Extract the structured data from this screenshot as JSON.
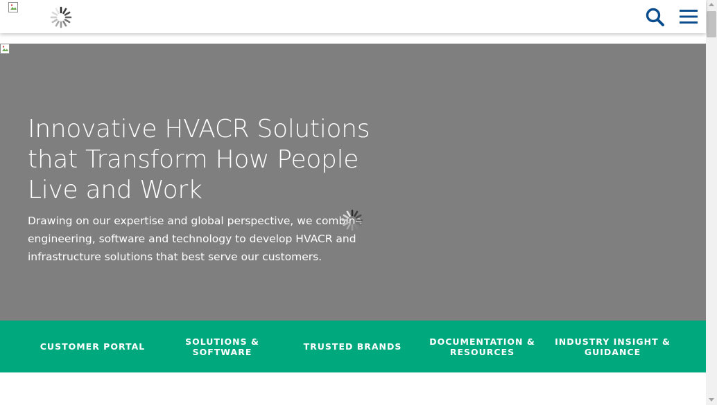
{
  "header": {
    "logo_icon": "broken-image-icon",
    "loading_icon": "spinner-icon",
    "search_icon": "search-icon",
    "menu_icon": "hamburger-menu-icon"
  },
  "hero": {
    "title": "Innovative HVACR Solutions that Transform How People Live and Work",
    "description": "Drawing on our expertise and global perspective, we combine engineering, software and technology to develop HVACR and infrastructure solutions that best serve our customers."
  },
  "nav": {
    "items": [
      {
        "label": "CUSTOMER PORTAL"
      },
      {
        "label": "SOLUTIONS & SOFTWARE"
      },
      {
        "label": "TRUSTED BRANDS"
      },
      {
        "label": "DOCUMENTATION & RESOURCES"
      },
      {
        "label": "INDUSTRY INSIGHT & GUIDANCE"
      }
    ]
  },
  "colors": {
    "header_bg": "#ffffff",
    "icon_blue": "#0b4c8c",
    "hero_bg": "#7f7f7f",
    "nav_bg": "#00a87e",
    "text_white": "#ffffff"
  }
}
